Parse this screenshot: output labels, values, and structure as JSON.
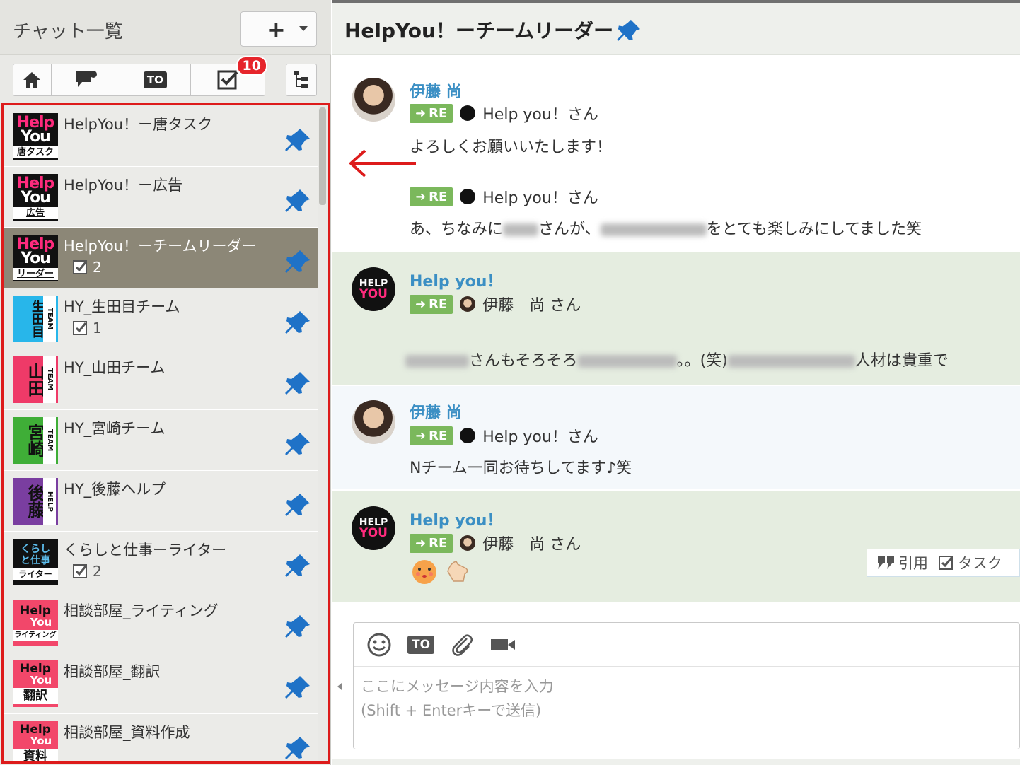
{
  "sidebar": {
    "title": "チャット一覧",
    "add_label": "+",
    "filter": {
      "task_badge": "10",
      "to_label": "TO"
    },
    "rooms": [
      {
        "name": "HelpYou！ー唐タスク",
        "icon_line1": "Help",
        "icon_line2": "You",
        "icon_line3": "唐タスク",
        "task_count": ""
      },
      {
        "name": "HelpYou！ー広告",
        "icon_line1": "Help",
        "icon_line2": "You",
        "icon_line3": "広告",
        "task_count": ""
      },
      {
        "name": "HelpYou！ーチームリーダー",
        "icon_line1": "Help",
        "icon_line2": "You",
        "icon_line3": "リーダー",
        "task_count": "2"
      },
      {
        "name": "HY_生田目チーム",
        "icon_big": "生田目",
        "icon_small": "TEAM",
        "task_count": "1"
      },
      {
        "name": "HY_山田チーム",
        "icon_big": "山田",
        "icon_small": "TEAM",
        "task_count": ""
      },
      {
        "name": "HY_宮崎チーム",
        "icon_big": "宮崎",
        "icon_small": "TEAM",
        "task_count": ""
      },
      {
        "name": "HY_後藤ヘルプ",
        "icon_big": "後藤",
        "icon_small": "HELP",
        "task_count": ""
      },
      {
        "name": "くらしと仕事ーライター",
        "icon_line1": "くらし\nと仕事",
        "icon_line3": "ライター",
        "task_count": "2"
      },
      {
        "name": "相談部屋_ライティング",
        "icon_line1": "Help",
        "icon_line2": "You",
        "icon_line3": "ライティング",
        "task_count": ""
      },
      {
        "name": "相談部屋_翻訳",
        "icon_line1": "Help",
        "icon_line2": "You",
        "icon_line3": "翻訳",
        "task_count": ""
      },
      {
        "name": "相談部屋_資料作成",
        "icon_line1": "Help",
        "icon_line2": "You",
        "icon_line3": "資料",
        "task_count": ""
      }
    ]
  },
  "header": {
    "title": "HelpYou！ーチームリーダー"
  },
  "messages": [
    {
      "sender": "伊藤 尚",
      "replies": [
        {
          "re": "RE",
          "to": "Help you！さん",
          "text": "よろしくお願いいたします！"
        },
        {
          "re": "RE",
          "to": "Help you！さん",
          "text_a": "あ、ちなみに",
          "text_b": "さんが、",
          "text_c": "をとても楽しみにしてました笑"
        }
      ]
    },
    {
      "sender": "Help you！",
      "re": "RE",
      "to": "伊藤　尚 さん",
      "text_a": "さんもそろそろ",
      "text_b": "。。(笑)",
      "text_c": "人材は貴重で"
    },
    {
      "sender": "伊藤 尚",
      "re": "RE",
      "to": "Help you！さん",
      "text": "Nチーム一同お待ちしてます♪笑"
    },
    {
      "sender": "Help you！",
      "re": "RE",
      "to": "伊藤　尚 さん"
    }
  ],
  "actions": {
    "quote": "引用",
    "task": "タスク"
  },
  "composer": {
    "to_label": "TO",
    "placeholder": "ここにメッセージ内容を入力\n(Shift + Enterキーで送信)"
  },
  "colors": {
    "accent_red": "#e6252b",
    "sender_blue": "#3b8fc4",
    "re_green": "#7bb85c",
    "active_room": "#8c8777"
  }
}
